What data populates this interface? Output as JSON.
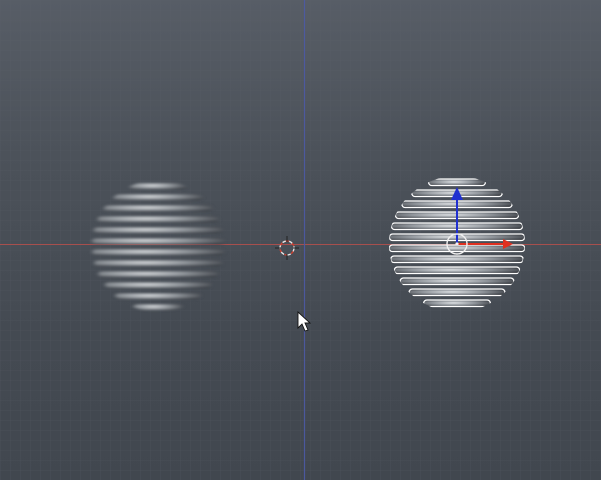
{
  "viewport": {
    "kind": "3d-viewport",
    "axis_colors": {
      "x_axis": "#c0504d",
      "z_axis": "#4a5aa8",
      "gizmo_x": "#e03020",
      "gizmo_z": "#2030d0"
    },
    "background_color": "#4b5159",
    "grid_color": "#5a6068",
    "objects": [
      {
        "name": "sphere-ghost",
        "style": "motion-blurred striped sphere",
        "selected": false
      },
      {
        "name": "sphere-selected",
        "style": "striped sphere with white outline",
        "selected": true
      }
    ],
    "cursor_icon": "arrow-cursor-icon",
    "origin_icon": "3d-cursor-icon",
    "gizmo_icon": "transform-gizmo-icon"
  }
}
